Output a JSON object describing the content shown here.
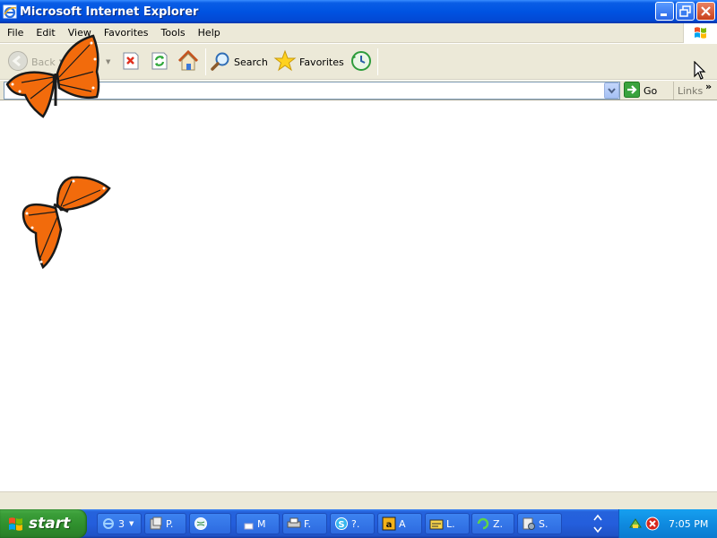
{
  "window": {
    "title": "Microsoft Internet Explorer"
  },
  "menu": {
    "items": [
      "File",
      "Edit",
      "View",
      "Favorites",
      "Tools",
      "Help"
    ]
  },
  "toolbar": {
    "back_label": "Back",
    "search_label": "Search",
    "favorites_label": "Favorites"
  },
  "address": {
    "value": "",
    "go_label": "Go",
    "links_label": "Links",
    "more_label": "»"
  },
  "taskbar": {
    "start_label": "start",
    "buttons": [
      {
        "label": "3",
        "icon": "ie-icon"
      },
      {
        "label": "P.",
        "icon": "application-icon"
      },
      {
        "label": "",
        "icon": "globe-icon"
      },
      {
        "label": "M",
        "icon": "window-icon"
      },
      {
        "label": "F.",
        "icon": "printer-icon"
      },
      {
        "label": "?.",
        "icon": "skype-icon"
      },
      {
        "label": "A",
        "icon": "amazon-icon"
      },
      {
        "label": "L.",
        "icon": "app-icon"
      },
      {
        "label": "Z.",
        "icon": "green-app-icon"
      },
      {
        "label": "S.",
        "icon": "settings-icon"
      }
    ],
    "clock": "7:05 PM"
  },
  "colors": {
    "titlebar": "#0053e1",
    "chrome": "#ece9d8",
    "start_button": "#3b9e39",
    "taskbar": "#245edc",
    "tray": "#0f8be0",
    "butterfly_orange": "#f26b0c"
  }
}
